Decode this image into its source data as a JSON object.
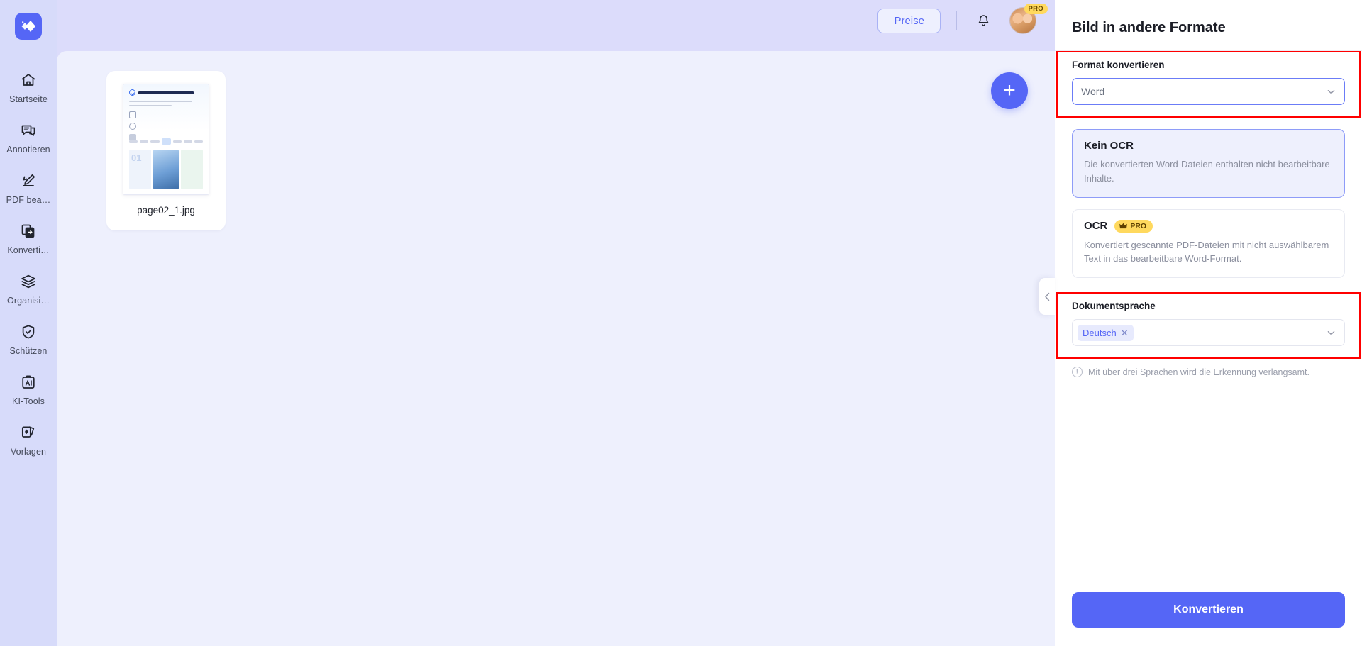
{
  "app": {
    "logo_icon": "diamond-sparkle-logo"
  },
  "sidebar": {
    "items": [
      {
        "label": "Startseite",
        "icon": "home-icon"
      },
      {
        "label": "Annotieren",
        "icon": "comment-icon"
      },
      {
        "label": "PDF bea…",
        "icon": "pencil-edit-icon"
      },
      {
        "label": "Konverti…",
        "icon": "convert-files-icon"
      },
      {
        "label": "Organisi…",
        "icon": "layers-icon"
      },
      {
        "label": "Schützen",
        "icon": "shield-check-icon"
      },
      {
        "label": "KI-Tools",
        "icon": "ai-clipboard-icon"
      },
      {
        "label": "Vorlagen",
        "icon": "cards-template-icon"
      }
    ]
  },
  "header": {
    "pricing_label": "Preise",
    "bell_icon": "notification-bell-icon",
    "avatar_icon": "user-avatar",
    "pro_badge": "PRO"
  },
  "canvas": {
    "file": {
      "name": "page02_1.jpg"
    },
    "add_button_label": "+",
    "add_button_icon": "plus-icon"
  },
  "panel": {
    "title": "Bild in andere Formate",
    "format_section": {
      "label": "Format konvertieren",
      "selected": "Word",
      "chevron_icon": "chevron-down-icon",
      "highlight_color": "#ff0000"
    },
    "ocr_options": [
      {
        "title": "Kein OCR",
        "description": "Die konvertierten Word-Dateien enthalten nicht bearbeitbare Inhalte.",
        "selected": true,
        "badge": null
      },
      {
        "title": "OCR",
        "description": "Konvertiert gescannte PDF-Dateien mit nicht auswählbarem Text in das bearbeitbare Word-Format.",
        "selected": false,
        "badge": "PRO",
        "badge_icon": "crown-icon"
      }
    ],
    "language_section": {
      "label": "Dokumentsprache",
      "chips": [
        {
          "label": "Deutsch",
          "remove_icon": "close-icon"
        }
      ],
      "chevron_icon": "chevron-down-icon",
      "highlight_color": "#ff0000"
    },
    "hint": {
      "icon": "info-exclamation-icon",
      "text": "Mit über drei Sprachen wird die Erkennung verlangsamt."
    },
    "convert_button": "Konvertieren",
    "collapse_icon": "chevron-left-icon"
  },
  "colors": {
    "accent": "#5566f6",
    "sidebar_bg": "#d7dbfa",
    "canvas_bg": "#eef0fd",
    "highlight": "#ff0000",
    "pro_yellow": "#ffd95e"
  }
}
